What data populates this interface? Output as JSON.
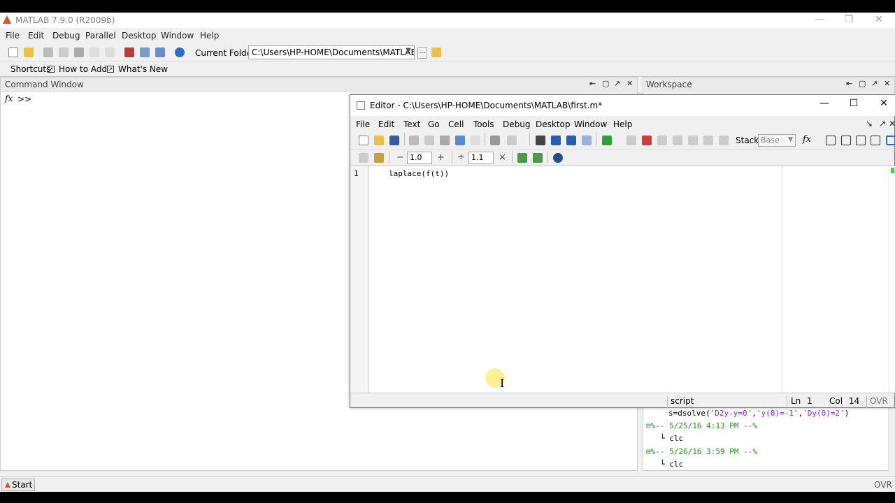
{
  "app": {
    "title": "MATLAB  7.9.0 (R2009b)"
  },
  "window_controls": {
    "minimize": "—",
    "restore": "❐",
    "close": "✕"
  },
  "menu": [
    "File",
    "Edit",
    "Debug",
    "Parallel",
    "Desktop",
    "Window",
    "Help"
  ],
  "toolbar": {
    "icons": [
      "new-file-icon",
      "open-folder-icon",
      "cut-icon",
      "copy-icon",
      "paste-icon",
      "undo-icon",
      "redo-icon",
      "simulink-icon",
      "guide-icon",
      "profiler-icon",
      "help-icon"
    ],
    "current_folder_label": "Current Folder:",
    "current_folder_value": "C:\\Users\\HP-HOME\\Documents\\MATLAB",
    "browse_label": "..."
  },
  "shortcuts": {
    "items": [
      "Shortcuts",
      "How to Add",
      "What's New"
    ]
  },
  "command_window": {
    "title": "Command Window",
    "prompt_icon": "fx",
    "prompt": ">>"
  },
  "workspace": {
    "title": "Workspace"
  },
  "history": {
    "lines": [
      "s=dsolve('D2y-y=0','y(0)=-1','Dy(0)=2')",
      "%-- 5/25/16  4:13 PM --%",
      "clc",
      "%-- 5/26/16  3:59 PM --%",
      "clc"
    ]
  },
  "status": {
    "start_label": "Start",
    "ovr": "OVR"
  },
  "editor": {
    "title": "Editor - C:\\Users\\HP-HOME\\Documents\\MATLAB\\first.m*",
    "menu": [
      "File",
      "Edit",
      "Text",
      "Go",
      "Cell",
      "Tools",
      "Debug",
      "Desktop",
      "Window",
      "Help"
    ],
    "stack_label": "Stack:",
    "stack_value": "Base",
    "cell_minus": "−",
    "cell_plus": "+",
    "cell_divide": "÷",
    "cell_times": "×",
    "cell_value_1": "1.0",
    "cell_value_2": "1.1",
    "line_number": "1",
    "code": "laplace(f(t))",
    "status_type": "script",
    "status_ln_label": "Ln",
    "status_ln": "1",
    "status_col_label": "Col",
    "status_col": "14",
    "status_ovr": "OVR"
  },
  "colors": {
    "string": "#a020f0",
    "comment": "#228b22",
    "code": "#000000",
    "accent": "#d9541e"
  }
}
